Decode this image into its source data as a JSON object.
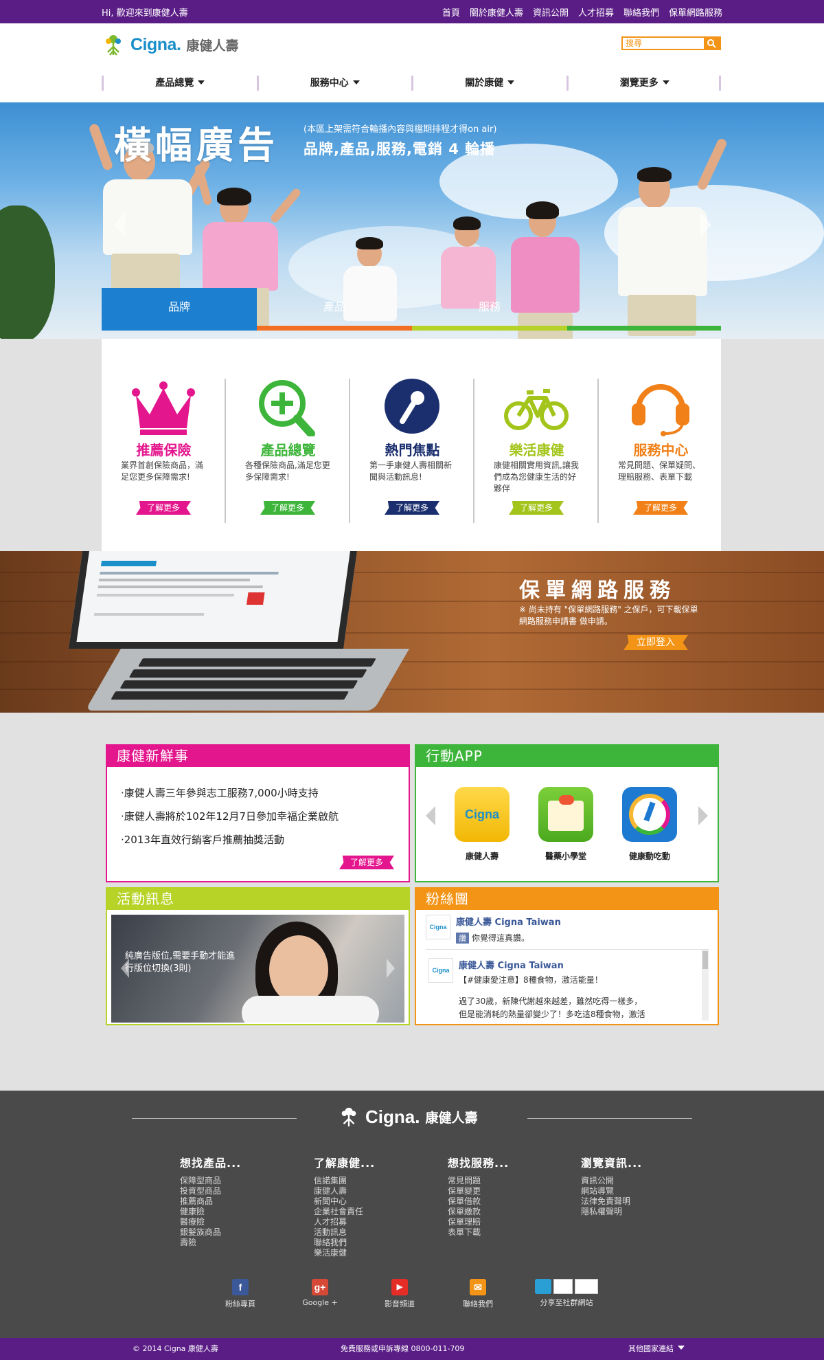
{
  "topbar": {
    "greeting": "Hi, 歡迎來到康健人壽",
    "links": [
      "首頁",
      "關於康健人壽",
      "資訊公開",
      "人才招募",
      "聯絡我們",
      "保單網路服務"
    ]
  },
  "header": {
    "brand": "Cigna.",
    "brand_zh": "康健人壽",
    "search_placeholder": "搜尋",
    "nav": [
      "產品總覽",
      "服務中心",
      "關於康健",
      "瀏覽更多"
    ]
  },
  "hero": {
    "title": "橫幅廣告",
    "note": "(本區上架需符合輪播內容與檔期排程才得on air)",
    "subtitle": "品牌,產品,服務,電銷 4 輪播",
    "tabs": [
      "品牌",
      "產品",
      "服務"
    ]
  },
  "features": [
    {
      "title": "推薦保險",
      "desc": "業界首創保險商品，滿足您更多保障需求!",
      "more": "了解更多",
      "color": "#e4168d",
      "icon": "crown-icon"
    },
    {
      "title": "產品總覽",
      "desc": "各種保險商品,滿足您更多保障需求!",
      "more": "了解更多",
      "color": "#3db53a",
      "icon": "magnifier-plus-icon"
    },
    {
      "title": "熱門焦點",
      "desc": "第一手康健人壽相關新聞與活動訊息!",
      "more": "了解更多",
      "color": "#1b2f6e",
      "icon": "microphone-icon"
    },
    {
      "title": "樂活康健",
      "desc": "康健相關實用資訊,讓我們成為您健康生活的好夥伴",
      "more": "了解更多",
      "color": "#a3c41a",
      "icon": "bicycle-icon"
    },
    {
      "title": "服務中心",
      "desc": "常見問題、保單疑問、理賠服務、表單下載",
      "more": "了解更多",
      "color": "#f08017",
      "icon": "headset-icon"
    }
  ],
  "online": {
    "title": "保單網路服務",
    "note": "※ 尚未持有 \"保單網路服務\" 之保戶，可下載保單網路服務申請書 做申請。",
    "login": "立即登入"
  },
  "news": {
    "title": "康健新鮮事",
    "items": [
      "·康健人壽三年參與志工服務7,000小時支持",
      "·康健人壽將於102年12月7日參加幸福企業啟航",
      "·2013年直效行銷客戶推薦抽獎活動"
    ],
    "more": "了解更多"
  },
  "app": {
    "title": "行動APP",
    "apps": [
      "康健人壽",
      "醫藥小學堂",
      "健康動吃動"
    ]
  },
  "event": {
    "title": "活動訊息",
    "text": "純廣告版位,需要手動才能進行版位切換(3則)"
  },
  "fans": {
    "title": "粉絲團",
    "page_name": "康健人壽 Cigna Taiwan",
    "like": "讚",
    "like_text": "你覺得這真讚。",
    "post_name": "康健人壽 Cigna Taiwan",
    "post_tag": "【#健康愛注意】8種食物，激活能量！",
    "post_body1": "過了30歲，新陳代謝越來越差，雖然吃得一樣多，",
    "post_body2": "但是能消耗的熱量卻變少了！多吃這8種食物，激活"
  },
  "footer": {
    "brand": "Cigna.",
    "brand_zh": "康健人壽",
    "columns": [
      {
        "title": "想找產品...",
        "items": [
          "保障型商品",
          "投資型商品",
          "推薦商品",
          "健康險",
          "醫療險",
          "銀髮族商品",
          "壽險"
        ]
      },
      {
        "title": "了解康健...",
        "items": [
          "信諾集團",
          "康健人壽",
          "新聞中心",
          "企業社會責任",
          "人才招募",
          "活動訊息",
          "聯絡我們",
          "樂活康健"
        ]
      },
      {
        "title": "想找服務...",
        "items": [
          "常見問題",
          "保單變更",
          "保單借款",
          "保單繳款",
          "保單理賠",
          "表單下載"
        ]
      },
      {
        "title": "瀏覽資訊...",
        "items": [
          "資訊公開",
          "網站導覽",
          "法律免責聲明",
          "隱私權聲明"
        ]
      }
    ],
    "social": [
      {
        "label": "粉絲專頁",
        "glyph": "f",
        "color": "#3b5998"
      },
      {
        "label": "Google +",
        "glyph": "g+",
        "color": "#d64937"
      },
      {
        "label": "影音頻道",
        "glyph": "▶",
        "color": "#e52d27"
      },
      {
        "label": "聯絡我們",
        "glyph": "✉",
        "color": "#f39417"
      }
    ],
    "share_label": "分享至社群網站",
    "bottom": {
      "copyright": "© 2014 Cigna 康健人壽",
      "hotline": "免費服務或申訴專線 0800-011-709",
      "other": "其他國家連結"
    }
  }
}
